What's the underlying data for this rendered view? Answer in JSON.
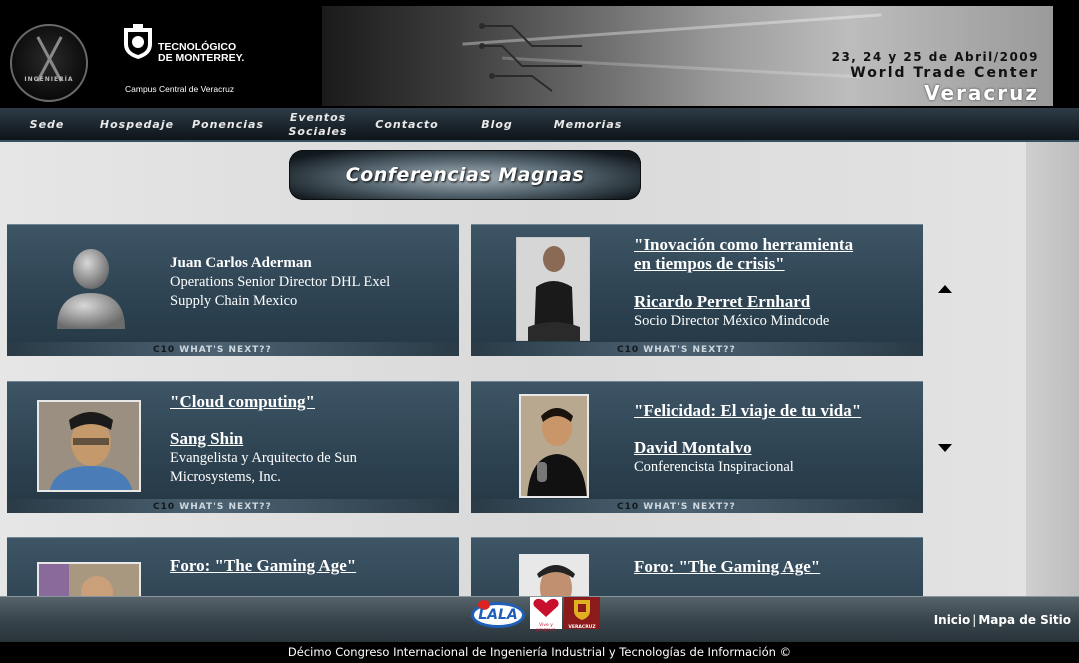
{
  "header": {
    "logo_ring_text": "INGENIERÍA",
    "tec_name_line1": "TECNOLÓGICO",
    "tec_name_line2": "DE MONTERREY.",
    "campus": "Campus Central de Veracruz",
    "banner": {
      "date": "23, 24 y 25 de Abril/2009",
      "venue": "World Trade Center",
      "city": "Veracruz"
    }
  },
  "nav": {
    "items": [
      {
        "label": "Sede"
      },
      {
        "label": "Hospedaje"
      },
      {
        "label": "Ponencias"
      },
      {
        "label_line1": "Eventos",
        "label_line2": "Sociales"
      },
      {
        "label": "Contacto"
      },
      {
        "label": "Blog"
      },
      {
        "label": "Memorias"
      }
    ]
  },
  "section": {
    "title": "Conferencias Magnas"
  },
  "cards": [
    {
      "speaker": "Juan Carlos Aderman",
      "role_line1": "Operations Senior Director DHL Exel",
      "role_line2": "Supply Chain Mexico",
      "footer_code": "C10",
      "footer_text": "WHAT'S NEXT??"
    },
    {
      "title_line1": "\"Inovación como herramienta",
      "title_line2": "en tiempos de crisis\"",
      "speaker": "Ricardo Perret Ernhard",
      "role_line1": "Socio Director México Mindcode",
      "footer_code": "C10",
      "footer_text": "WHAT'S NEXT??"
    },
    {
      "title_line1": "\"Cloud computing\"",
      "speaker": "Sang Shin",
      "role_line1": "Evangelista y Arquitecto de Sun",
      "role_line2": "Microsystems, Inc.",
      "footer_code": "C10",
      "footer_text": "WHAT'S NEXT??"
    },
    {
      "title_line1": "\"Felicidad: El viaje de tu vida\"",
      "speaker": "David Montalvo",
      "role_line1": "Conferencista Inspiracional",
      "footer_code": "C10",
      "footer_text": "WHAT'S NEXT??"
    },
    {
      "title_line1": "Foro: \"The Gaming Age\""
    },
    {
      "title_line1": "Foro: \"The Gaming Age\""
    }
  ],
  "sponsors": {
    "lala": "LALA",
    "heart_tagline": "Vive y progresa",
    "city_hall": "VERACRUZ"
  },
  "footer": {
    "link_home": "Inicio",
    "separator": "|",
    "link_sitemap": "Mapa de Sitio",
    "copyright": "Décimo Congreso Internacional de Ingeniería Industrial y Tecnologías de Información ©"
  },
  "colors": {
    "card_bg": "#2f4554",
    "nav_bg": "#1b252d",
    "page_bg": "#dddddd"
  }
}
